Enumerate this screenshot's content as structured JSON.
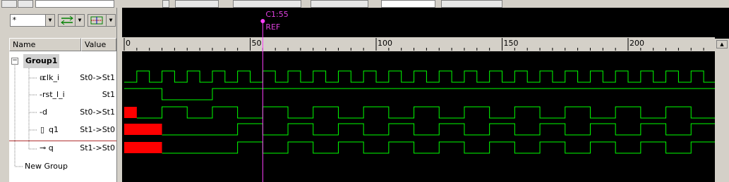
{
  "cursor": {
    "label": "C1:55",
    "ref": "REF",
    "time": 55
  },
  "filter": {
    "value": "*"
  },
  "columns": {
    "name": "Name",
    "value": "Value"
  },
  "timeline": {
    "ticks": [
      "0",
      "50",
      "100",
      "150",
      "200"
    ]
  },
  "group": {
    "name": "Group1"
  },
  "signals": [
    {
      "name": "clk_i",
      "value": "St0->St1"
    },
    {
      "name": "rst_l_i",
      "value": "St1"
    },
    {
      "name": "d",
      "value": "St0->St1"
    },
    {
      "name": "q1",
      "value": "St1->St0"
    },
    {
      "name": "q",
      "value": "St1->St0"
    }
  ],
  "new_group": {
    "name": "New Group"
  },
  "colors": {
    "wave": "#00ff00",
    "cursor": "#ff40ff",
    "unknown": "#ff0000",
    "cursor_text": "#e040e0"
  }
}
